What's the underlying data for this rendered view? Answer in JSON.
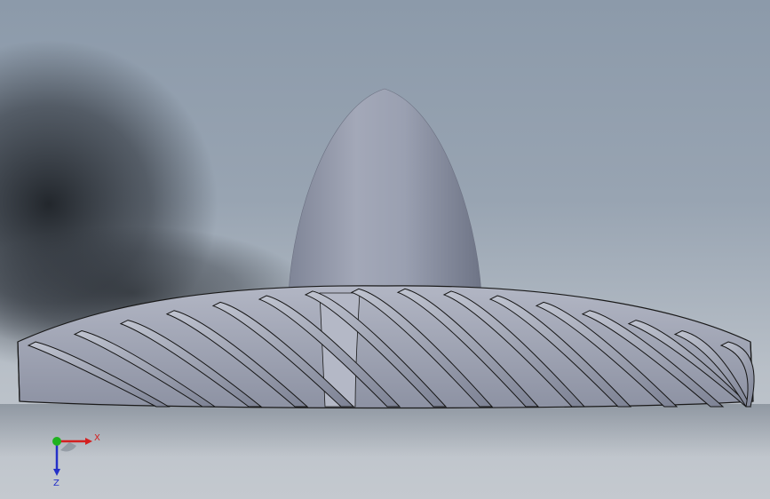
{
  "viewport": {
    "background_top": "#8c9aaa",
    "background_bottom": "#c4c9cf",
    "model_color": "#a7abba",
    "model_edge_color": "#1a1a1a"
  },
  "triad": {
    "x_label": "X",
    "z_label": "Z",
    "x_color": "#d42020",
    "y_color": "#1fb21f",
    "z_color": "#2430c8"
  }
}
